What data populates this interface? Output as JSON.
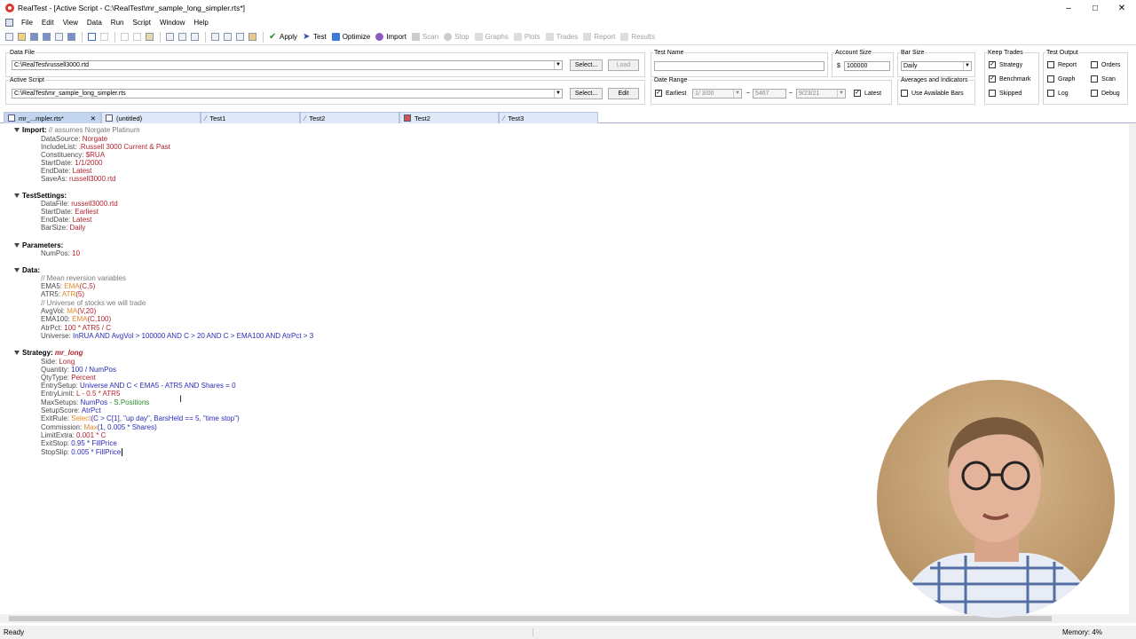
{
  "window": {
    "title": "RealTest - [Active Script - C:\\RealTest\\mr_sample_long_simpler.rts*]"
  },
  "menu": [
    "File",
    "Edit",
    "View",
    "Data",
    "Run",
    "Script",
    "Window",
    "Help"
  ],
  "toolbar": {
    "apply": "Apply",
    "test": "Test",
    "optimize": "Optimize",
    "import": "Import",
    "scan": "Scan",
    "stop": "Stop",
    "graphs": "Graphs",
    "plots": "Plots",
    "trades": "Trades",
    "report": "Report",
    "results": "Results"
  },
  "panel": {
    "data_file_label": "Data File",
    "data_file": "C:\\RealTest\\russell3000.rtd",
    "select1": "Select...",
    "load": "Load",
    "active_script_label": "Active Script",
    "active_script": "C:\\RealTest\\mr_sample_long_simpler.rts",
    "select2": "Select...",
    "edit": "Edit",
    "test_name_label": "Test Name",
    "test_name": "",
    "account_size_label": "Account Size",
    "account_currency": "$",
    "account_size": "100000",
    "bar_size_label": "Bar Size",
    "bar_size": "Daily",
    "date_range_label": "Date Range",
    "earliest": "Earliest",
    "start_date": "1/ 3/00",
    "bars": "5467",
    "end_date": "9/23/21",
    "latest": "Latest",
    "avg_label": "Averages and Indicators",
    "use_available": "Use Available Bars",
    "keep_trades_label": "Keep Trades",
    "strategy": "Strategy",
    "benchmark": "Benchmark",
    "skipped": "Skipped",
    "test_output_label": "Test Output",
    "report": "Report",
    "graph": "Graph",
    "log": "Log",
    "orders": "Orders",
    "scan": "Scan",
    "debug": "Debug"
  },
  "tabs": [
    "mr_...mpler.rts*",
    "(untitled)",
    "Test1",
    "Test2",
    "Test2",
    "Test3"
  ],
  "script": {
    "import": {
      "head": "Import:",
      "comment": "// assumes Norgate Platinum",
      "lines": [
        [
          "DataSource:",
          "Norgate"
        ],
        [
          "IncludeList:",
          ".Russell 3000 Current & Past"
        ],
        [
          "Constituency:",
          "$RUA"
        ],
        [
          "StartDate:",
          "1/1/2000"
        ],
        [
          "EndDate:",
          "Latest"
        ],
        [
          "SaveAs:",
          "russell3000.rtd"
        ]
      ]
    },
    "testsettings": {
      "head": "TestSettings:",
      "lines": [
        [
          "DataFile:",
          "russell3000.rtd"
        ],
        [
          "StartDate:",
          "Earliest"
        ],
        [
          "EndDate:",
          "Latest"
        ],
        [
          "BarSize:",
          "Daily"
        ]
      ]
    },
    "parameters": {
      "head": "Parameters:",
      "lines": [
        [
          "NumPos:",
          "10"
        ]
      ]
    },
    "data": {
      "head": "Data:",
      "c1": "// Mean reversion variables",
      "ema5": "EMA5:",
      "ema5fn": "EMA",
      "ema5args": "(C,5)",
      "atr5": "ATR5:",
      "atr5fn": "ATR",
      "atr5args": "(5)",
      "c2": "// Universe of stocks we will trade",
      "avgvol": "AvgVol:",
      "avgvolfn": "MA",
      "avgvolargs": "(V,20)",
      "ema100": "EMA100:",
      "ema100fn": "EMA",
      "ema100args": "(C,100)",
      "atrpct": "AtrPct:",
      "atrpctexpr": "100 * ATR5 / C",
      "universe": "Universe:",
      "universeexpr": "InRUA AND AvgVol > 100000 AND C > 20 AND C > EMA100 AND AtrPct > 3"
    },
    "strategy": {
      "head": "Strategy:",
      "name": "mr_long",
      "side": "Side:",
      "sidev": "Long",
      "qty": "Quantity:",
      "qtyv": "100 / NumPos",
      "qtytype": "QtyType:",
      "qtytypev": "Percent",
      "entrysetup": "EntrySetup:",
      "entrysetupv": "Universe AND C < EMA5 - ATR5 AND Shares = 0",
      "entrylimit": "EntryLimit:",
      "entrylimitv": "L - 0.5 * ATR5",
      "maxsetups": "MaxSetups:",
      "maxsetupsv1": "NumPos",
      "maxsetupsv2": " - S.Positions",
      "setupscore": "SetupScore:",
      "setupscorev": "AtrPct",
      "exitrule": "ExitRule:",
      "exitrulefn": "Select",
      "exitrulev": "(C > C[1], \"up day\", BarsHeld == 5, \"time stop\")",
      "commission": "Commission:",
      "commissionfn": "Max",
      "commissionv": "(1, 0.005 * Shares)",
      "limitextra": "LimitExtra:",
      "limitextrav": "0.001 * C",
      "exitstop": "ExitStop:",
      "exitstopv": "0.95 * FillPrice",
      "stopslip": "StopSlip:",
      "stopslipv": "0.005 * FillPrice"
    }
  },
  "status": {
    "ready": "Ready",
    "memory": "Memory: 4%"
  }
}
